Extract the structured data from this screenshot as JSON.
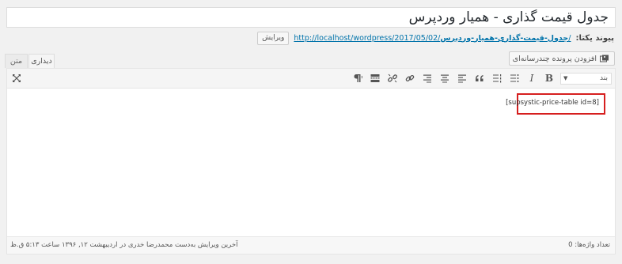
{
  "title": {
    "value": "جدول قیمت گذاری - همیار وردپرس"
  },
  "permalink": {
    "label": "پیوند یکتا:",
    "url_base": "http://localhost/wordpress/2017/05/02/",
    "url_slug": "جدول-قیمت-گذاری-همیار-وردپرس",
    "url_end": "/",
    "edit_button": "ویرایش"
  },
  "editor_tabs": {
    "visual": "دیداری",
    "text": "متن"
  },
  "add_media_button": "افزودن پرونده چندرسانه‌ای",
  "toolbar": {
    "format_select": "بند",
    "buttons": [
      "bold-icon",
      "italic-icon",
      "bullet-list-icon",
      "numbered-list-icon",
      "blockquote-icon",
      "align-left-icon",
      "align-center-icon",
      "align-right-icon",
      "link-icon",
      "unlink-icon",
      "toolbar-toggle-icon",
      "paragraph-icon"
    ],
    "bold_label": "B",
    "italic_label": "I"
  },
  "content": {
    "shortcode": "[supsystic-price-table id=8]"
  },
  "status_bar": {
    "word_count": "تعداد واژه‌ها: 0",
    "last_edit": "آخرین ویرایش به‌دست محمدرضا خدری در اردیبهشت ۱۲, ۱۳۹۶ ساعت ۵:۱۳ ق.ظ"
  },
  "colors": {
    "highlight_border": "#d61f1f",
    "link": "#0073aa"
  }
}
